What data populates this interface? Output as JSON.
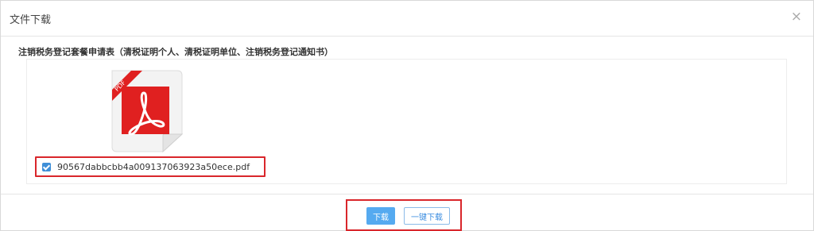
{
  "dialog": {
    "title": "文件下载",
    "close_glyph": "×"
  },
  "section": {
    "label": "注销税务登记套餐申请表（清税证明个人、清税证明单位、注销税务登记通知书）"
  },
  "file": {
    "type_badge": "PDF",
    "name": "90567dabbcbb4a009137063923a50ece.pdf",
    "checked": true
  },
  "buttons": {
    "download_label": "下载",
    "download_all_label": "一键下载"
  },
  "colors": {
    "accent_blue": "#55aaf0",
    "highlight_red": "#d9262b",
    "pdf_red": "#e02020"
  },
  "icons": {
    "close": "close-icon",
    "pdf": "pdf-file-icon",
    "checkbox": "checkbox-checked-icon"
  }
}
